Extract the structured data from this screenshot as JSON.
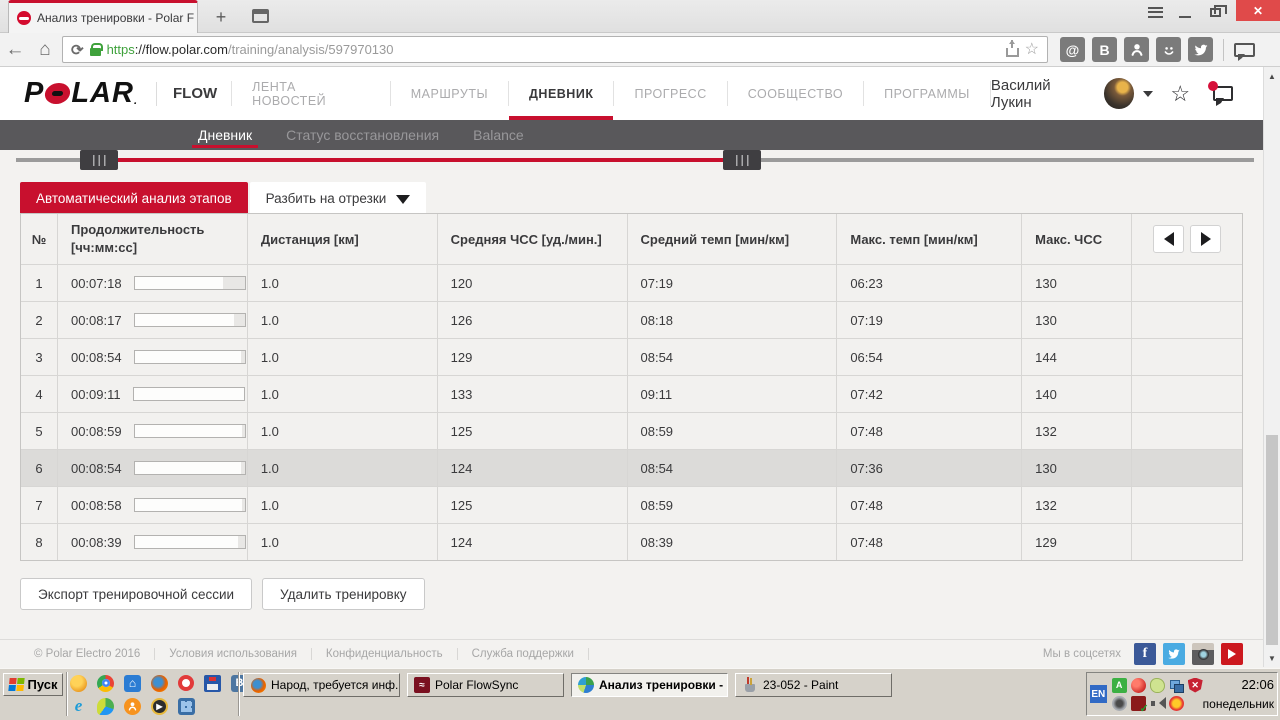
{
  "colors": {
    "accent_red": "#c8102e",
    "subnav_bg": "#59585b",
    "page_bg": "#f3f2f0",
    "taskbar_bg": "#d6d2ca"
  },
  "browser": {
    "tab_title": "Анализ тренировки - Polar F",
    "new_tab_label": "+",
    "close_glyph": "✕",
    "url": {
      "scheme": "https",
      "host": "://flow.polar.com",
      "path": "/training/analysis/597970130"
    },
    "extension_icons": [
      "mailru-at-icon",
      "vk-icon",
      "odnoklassniki-icon",
      "moymir-smiley-icon",
      "twitter-icon"
    ]
  },
  "pheader": {
    "logo_p": "P",
    "logo_lar": "LAR",
    "logo_dot": ".",
    "flow": "FLOW",
    "nav": [
      {
        "label": "ЛЕНТА НОВОСТЕЙ"
      },
      {
        "label": "МАРШРУТЫ"
      },
      {
        "label": "ДНЕВНИК"
      },
      {
        "label": "ПРОГРЕСС"
      },
      {
        "label": "СООБЩЕСТВО"
      },
      {
        "label": "ПРОГРАММЫ"
      }
    ],
    "active_nav": "ДНЕВНИК",
    "user_name": "Василий Лукин"
  },
  "subnav": {
    "items": [
      {
        "label": "Дневник"
      },
      {
        "label": "Статус восстановления"
      },
      {
        "label": "Balance"
      }
    ],
    "active": "Дневник"
  },
  "toolbar": {
    "auto_analysis": "Автоматический анализ этапов",
    "split": "Разбить на отрезки"
  },
  "table": {
    "columns": {
      "num": "№",
      "duration_l1": "Продолжительность",
      "duration_l2": "[чч:мм:сс]",
      "distance": "Дистанция [км]",
      "avg_hr": "Средняя ЧСС [уд./мин.]",
      "avg_pace": "Средний темп [мин/км]",
      "max_pace": "Макс. темп [мин/км]",
      "max_hr": "Макс. ЧСС"
    },
    "rows": [
      {
        "n": "1",
        "duration": "00:07:18",
        "bar_pct": 80,
        "distance": "1.0",
        "avg_hr": "120",
        "avg_pace": "07:19",
        "max_pace": "06:23",
        "max_hr": "130"
      },
      {
        "n": "2",
        "duration": "00:08:17",
        "bar_pct": 90,
        "distance": "1.0",
        "avg_hr": "126",
        "avg_pace": "08:18",
        "max_pace": "07:19",
        "max_hr": "130"
      },
      {
        "n": "3",
        "duration": "00:08:54",
        "bar_pct": 97,
        "distance": "1.0",
        "avg_hr": "129",
        "avg_pace": "08:54",
        "max_pace": "06:54",
        "max_hr": "144"
      },
      {
        "n": "4",
        "duration": "00:09:11",
        "bar_pct": 100,
        "distance": "1.0",
        "avg_hr": "133",
        "avg_pace": "09:11",
        "max_pace": "07:42",
        "max_hr": "140"
      },
      {
        "n": "5",
        "duration": "00:08:59",
        "bar_pct": 98,
        "distance": "1.0",
        "avg_hr": "125",
        "avg_pace": "08:59",
        "max_pace": "07:48",
        "max_hr": "132"
      },
      {
        "n": "6",
        "duration": "00:08:54",
        "bar_pct": 97,
        "distance": "1.0",
        "avg_hr": "124",
        "avg_pace": "08:54",
        "max_pace": "07:36",
        "max_hr": "130"
      },
      {
        "n": "7",
        "duration": "00:08:58",
        "bar_pct": 98,
        "distance": "1.0",
        "avg_hr": "125",
        "avg_pace": "08:59",
        "max_pace": "07:48",
        "max_hr": "132"
      },
      {
        "n": "8",
        "duration": "00:08:39",
        "bar_pct": 94,
        "distance": "1.0",
        "avg_hr": "124",
        "avg_pace": "08:39",
        "max_pace": "07:48",
        "max_hr": "129"
      }
    ],
    "highlighted_row": "6"
  },
  "actions": {
    "export": "Экспорт тренировочной сессии",
    "delete": "Удалить тренировку"
  },
  "footer": {
    "copyright": "© Polar Electro 2016",
    "links": [
      {
        "label": "Условия использования"
      },
      {
        "label": "Конфиденциальность"
      },
      {
        "label": "Служба поддержки"
      }
    ],
    "social_label": "Мы в соцсетях",
    "social_icons": [
      "facebook-icon",
      "twitter-icon",
      "instagram-icon",
      "youtube-icon"
    ]
  },
  "taskbar": {
    "start": "Пуск",
    "quick_launch_icons": [
      "amber-app-icon",
      "chrome-icon",
      "blue-house-icon",
      "firefox-icon",
      "opera-icon",
      "floppy-save-icon",
      "vk-icon",
      "internet-explorer-icon",
      "maps-icon",
      "odnoklassniki-icon",
      "media-player-icon",
      "blue-app-icon"
    ],
    "tasks": [
      {
        "label": "Народ, требуется инф...",
        "icon": "firefox-icon",
        "active": false
      },
      {
        "label": "Polar FlowSync",
        "icon": "flowsync-icon",
        "active": false
      },
      {
        "label": "Анализ тренировки - ...",
        "icon": "globe-browser-icon",
        "active": true
      },
      {
        "label": "23-052 - Paint",
        "icon": "paint-icon",
        "active": false
      }
    ],
    "tray": {
      "lang": "EN",
      "time": "22:06",
      "day": "понедельник",
      "icons": [
        "punto-switcher-icon",
        "virus-ball-icon",
        "blob-app-icon",
        "network-icon",
        "security-alert-icon",
        "webcam-icon",
        "flowsync-tray-icon",
        "volume-icon",
        "antivirus-icon"
      ]
    }
  }
}
